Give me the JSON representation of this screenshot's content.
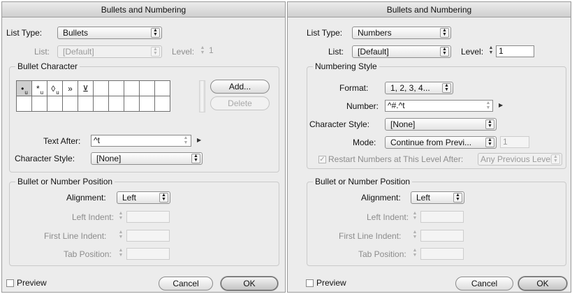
{
  "left_dialog": {
    "title": "Bullets and Numbering",
    "list_type": {
      "label": "List Type:",
      "value": "Bullets"
    },
    "list": {
      "label": "List:",
      "value": "[Default]"
    },
    "level": {
      "label": "Level:",
      "value": "1"
    },
    "bullet_character": {
      "title": "Bullet Character",
      "cells": [
        "•",
        "*",
        "◊",
        "»",
        "⊻",
        "",
        "",
        "",
        "",
        "",
        "",
        "",
        "",
        "",
        "",
        "",
        "",
        "",
        "",
        ""
      ],
      "cell_subs": [
        "u",
        "u",
        "u",
        "",
        "",
        "",
        "",
        "",
        "",
        "",
        "",
        "",
        "",
        "",
        "",
        "",
        "",
        "",
        "",
        ""
      ],
      "add_label": "Add...",
      "delete_label": "Delete"
    },
    "text_after": {
      "label": "Text After:",
      "value": "^t"
    },
    "character_style": {
      "label": "Character Style:",
      "value": "[None]"
    },
    "position": {
      "title": "Bullet or Number Position",
      "alignment": {
        "label": "Alignment:",
        "value": "Left"
      },
      "left_indent": {
        "label": "Left Indent:"
      },
      "first_line_indent": {
        "label": "First Line Indent:"
      },
      "tab_position": {
        "label": "Tab Position:"
      }
    },
    "preview_label": "Preview",
    "cancel_label": "Cancel",
    "ok_label": "OK"
  },
  "right_dialog": {
    "title": "Bullets and Numbering",
    "list_type": {
      "label": "List Type:",
      "value": "Numbers"
    },
    "list": {
      "label": "List:",
      "value": "[Default]"
    },
    "level": {
      "label": "Level:",
      "value": "1"
    },
    "numbering_style": {
      "title": "Numbering Style",
      "format": {
        "label": "Format:",
        "value": "1, 2, 3, 4..."
      },
      "number": {
        "label": "Number:",
        "value": "^#.^t"
      },
      "character_style": {
        "label": "Character Style:",
        "value": "[None]"
      },
      "mode": {
        "label": "Mode:",
        "value": "Continue from Previ...",
        "start_value": "1"
      },
      "restart": {
        "label": "Restart Numbers at This Level After:",
        "value": "Any Previous Level",
        "checked": true
      }
    },
    "position": {
      "title": "Bullet or Number Position",
      "alignment": {
        "label": "Alignment:",
        "value": "Left"
      },
      "left_indent": {
        "label": "Left Indent:"
      },
      "first_line_indent": {
        "label": "First Line Indent:"
      },
      "tab_position": {
        "label": "Tab Position:"
      }
    },
    "preview_label": "Preview",
    "cancel_label": "Cancel",
    "ok_label": "OK"
  }
}
